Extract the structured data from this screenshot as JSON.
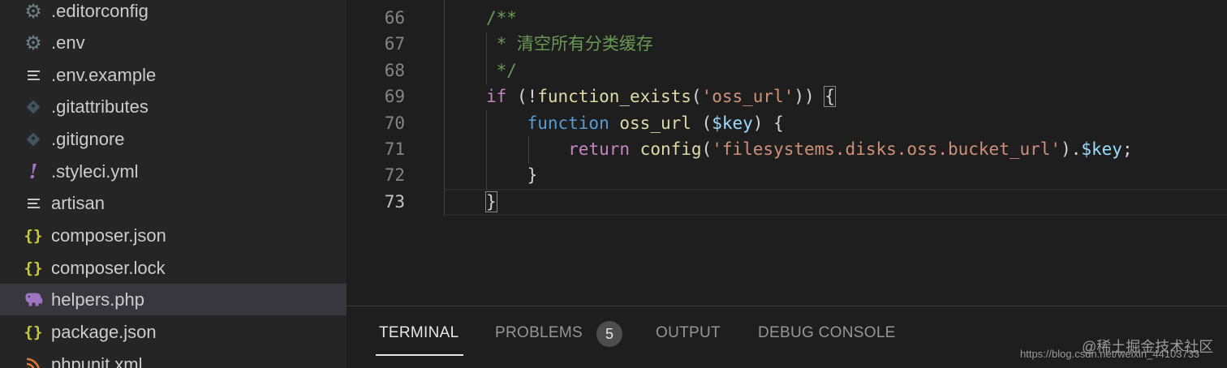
{
  "explorer": {
    "files": [
      {
        "name": ".editorconfig",
        "icon": "gear-icon"
      },
      {
        "name": ".env",
        "icon": "gear-icon"
      },
      {
        "name": ".env.example",
        "icon": "text-lines-icon"
      },
      {
        "name": ".gitattributes",
        "icon": "git-icon"
      },
      {
        "name": ".gitignore",
        "icon": "git-icon"
      },
      {
        "name": ".styleci.yml",
        "icon": "yaml-exclamation-icon"
      },
      {
        "name": "artisan",
        "icon": "text-lines-icon"
      },
      {
        "name": "composer.json",
        "icon": "json-braces-icon"
      },
      {
        "name": "composer.lock",
        "icon": "json-braces-icon"
      },
      {
        "name": "helpers.php",
        "icon": "php-elephant-icon",
        "selected": true
      },
      {
        "name": "package.json",
        "icon": "json-braces-icon"
      },
      {
        "name": "phpunit.xml",
        "icon": "rss-xml-icon"
      }
    ]
  },
  "editor": {
    "current_line": "73",
    "lines": [
      {
        "num": "66",
        "tokens": [
          {
            "t": "/**",
            "c": "comment"
          }
        ]
      },
      {
        "num": "67",
        "tokens": [
          {
            "t": " * 清空所有分类缓存",
            "c": "comment"
          }
        ]
      },
      {
        "num": "68",
        "tokens": [
          {
            "t": " */",
            "c": "comment"
          }
        ]
      },
      {
        "num": "69",
        "tokens": [
          {
            "t": "if",
            "c": "keyword"
          },
          {
            "t": " (!",
            "c": "plain"
          },
          {
            "t": "function_exists",
            "c": "function"
          },
          {
            "t": "(",
            "c": "plain"
          },
          {
            "t": "'oss_url'",
            "c": "string"
          },
          {
            "t": ")) {",
            "c": "plain"
          }
        ]
      },
      {
        "num": "70",
        "tokens": [
          {
            "t": "    ",
            "c": "plain"
          },
          {
            "t": "function",
            "c": "storage"
          },
          {
            "t": " ",
            "c": "plain"
          },
          {
            "t": "oss_url",
            "c": "function"
          },
          {
            "t": " (",
            "c": "plain"
          },
          {
            "t": "$key",
            "c": "variable"
          },
          {
            "t": ") {",
            "c": "plain"
          }
        ]
      },
      {
        "num": "71",
        "tokens": [
          {
            "t": "        ",
            "c": "plain"
          },
          {
            "t": "return",
            "c": "keyword"
          },
          {
            "t": " ",
            "c": "plain"
          },
          {
            "t": "config",
            "c": "function"
          },
          {
            "t": "(",
            "c": "plain"
          },
          {
            "t": "'filesystems.disks.oss.bucket_url'",
            "c": "string"
          },
          {
            "t": ").",
            "c": "plain"
          },
          {
            "t": "$key",
            "c": "variable"
          },
          {
            "t": ";",
            "c": "plain"
          }
        ]
      },
      {
        "num": "72",
        "tokens": [
          {
            "t": "    }",
            "c": "plain"
          }
        ]
      },
      {
        "num": "73",
        "tokens": [
          {
            "t": "}",
            "c": "plain"
          }
        ]
      }
    ]
  },
  "panel": {
    "tabs": [
      {
        "label": "TERMINAL",
        "active": true
      },
      {
        "label": "PROBLEMS",
        "badge": "5"
      },
      {
        "label": "OUTPUT"
      },
      {
        "label": "DEBUG CONSOLE"
      }
    ]
  },
  "watermark": {
    "brand": "@稀土掘金技术社区",
    "url": "https://blog.csdn.net/weixin_44103733"
  },
  "colors": {
    "comment": "#6a9955",
    "keyword": "#c586c0",
    "function": "#dcdcaa",
    "string": "#ce9178",
    "storage": "#569cd6",
    "variable": "#9cdcfe",
    "plain": "#d4d4d4"
  }
}
